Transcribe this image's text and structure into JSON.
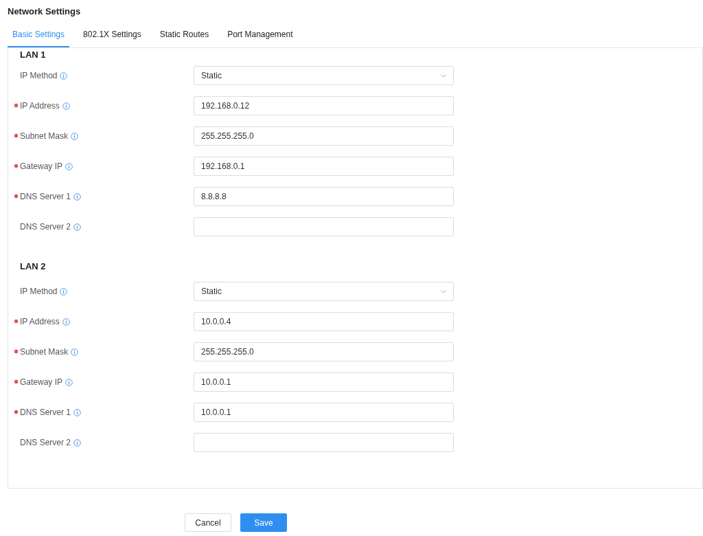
{
  "title": "Network Settings",
  "tabs": [
    {
      "label": "Basic Settings",
      "selected": true
    },
    {
      "label": "802.1X Settings",
      "selected": false
    },
    {
      "label": "Static Routes",
      "selected": false
    },
    {
      "label": "Port Management",
      "selected": false
    }
  ],
  "sections": [
    {
      "heading": "LAN 1",
      "fields": [
        {
          "kind": "select",
          "label": "IP Method",
          "required": false,
          "value": "Static"
        },
        {
          "kind": "text",
          "label": "IP Address",
          "required": true,
          "value": "192.168.0.12"
        },
        {
          "kind": "text",
          "label": "Subnet Mask",
          "required": true,
          "value": "255.255.255.0"
        },
        {
          "kind": "text",
          "label": "Gateway IP",
          "required": true,
          "value": "192.168.0.1"
        },
        {
          "kind": "text",
          "label": "DNS Server 1",
          "required": true,
          "value": "8.8.8.8"
        },
        {
          "kind": "text",
          "label": "DNS Server 2",
          "required": false
        }
      ]
    },
    {
      "heading": "LAN 2",
      "fields": [
        {
          "kind": "select",
          "label": "IP Method",
          "required": false,
          "value": "Static"
        },
        {
          "kind": "text",
          "label": "IP Address",
          "required": true,
          "value": "10.0.0.4"
        },
        {
          "kind": "text",
          "label": "Subnet Mask",
          "required": true,
          "value": "255.255.255.0"
        },
        {
          "kind": "text",
          "label": "Gateway IP",
          "required": true,
          "value": "10.0.0.1"
        },
        {
          "kind": "text",
          "label": "DNS Server 1",
          "required": true,
          "value": "10.0.0.1"
        },
        {
          "kind": "text",
          "label": "DNS Server 2",
          "required": false
        }
      ]
    }
  ],
  "buttons": [
    {
      "label": "Cancel",
      "kind": "secondary"
    },
    {
      "label": "Save",
      "kind": "primary"
    }
  ]
}
